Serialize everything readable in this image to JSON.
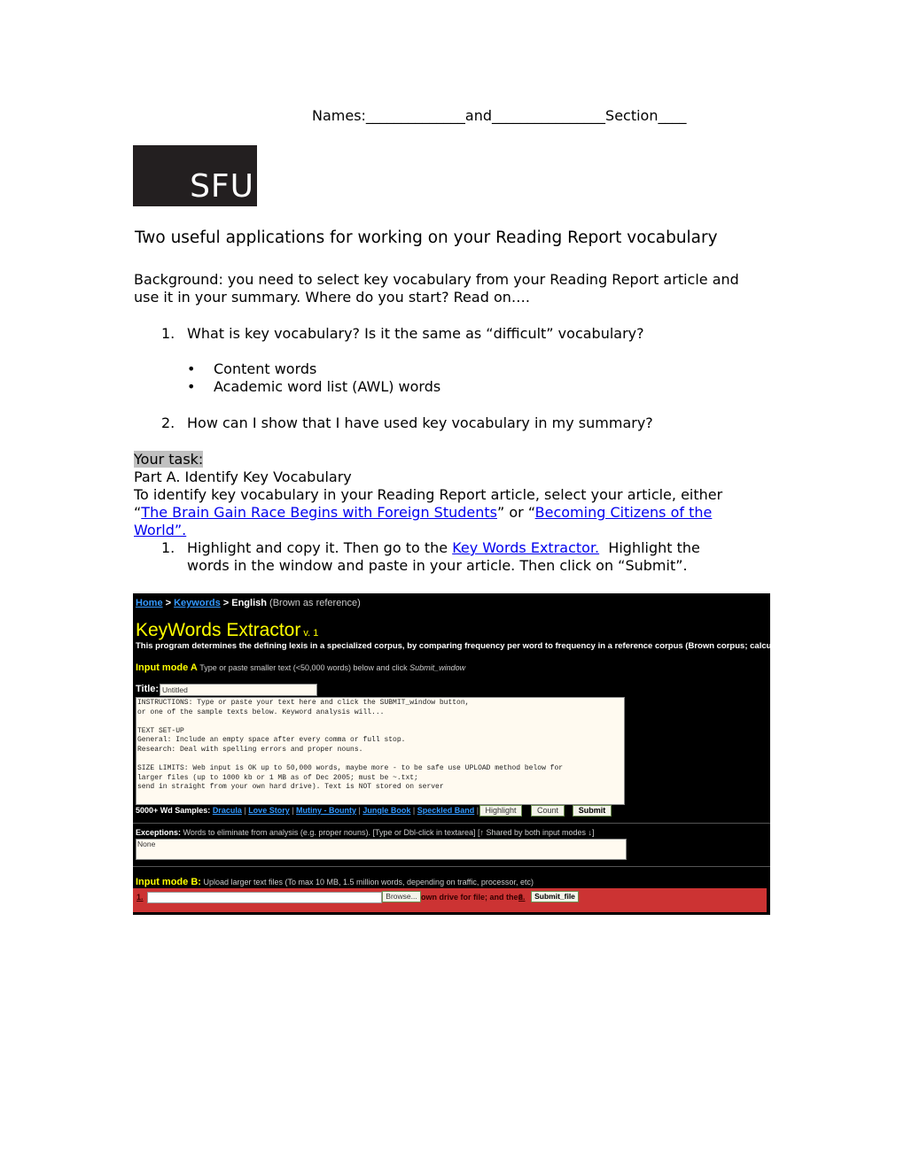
{
  "header": {
    "names_line": "Names:______________and________________Section____"
  },
  "logo": {
    "text": "SFU"
  },
  "heading": "Two useful applications for working on your Reading Report vocabulary",
  "background": {
    "line1": "Background: you need to select key vocabulary from your Reading Report article and",
    "line2": "use it in your summary.  Where do you start? Read on…."
  },
  "questions": [
    {
      "number": "1.",
      "text": "What is key vocabulary? Is it the same as “difficult” vocabulary?"
    },
    {
      "number": "2.",
      "text": "How can I show that I have used key vocabulary in my summary?"
    }
  ],
  "bullets": [
    "Content words",
    "Academic word list (AWL) words"
  ],
  "task": {
    "label": "Your task:",
    "part_a": "Part A. Identify Key Vocabulary",
    "intro": "To identify key vocabulary in your Reading Report article, select your article, either",
    "open_quote1": "“",
    "link1": "The Brain Gain Race Begins with Foreign Students",
    "mid": "” or “",
    "link2a": "Becoming Citizens of the ",
    "link2b": "World”. ",
    "step_number": "1.",
    "step_pre": "Highlight and copy it. Then go to the ",
    "step_link": "Key Words Extractor.",
    "step_post1": "  Highlight the",
    "step_post2": "words in the window and paste in your article. Then click on “Submit”."
  },
  "screenshot": {
    "breadcrumb": {
      "home": "Home",
      "sep1": " > ",
      "keywords": "Keywords",
      "sep2": " > ",
      "english": "English",
      "ref": " (Brown as reference)"
    },
    "app_title": "KeyWords Extractor",
    "version": " v. 1",
    "description": "This program determines the defining lexis in a specialized corpus, by comparing frequency per word to frequency in a reference corpus (Brown corpus; calculated on a",
    "mode_a_label": "Input mode A",
    "mode_a_text": " Type or paste smaller text (<50,000 words) below and click ",
    "mode_a_em": "Submit_window",
    "title_label": "Title:",
    "title_value": "Untitled",
    "textarea": "INSTRUCTIONS: Type or paste your text here and click the SUBMIT_window button,\nor one of the sample texts below. Keyword analysis will...\n\nTEXT SET-UP\nGeneral: Include an empty space after every comma or full stop.\nResearch: Deal with spelling errors and proper nouns.\n\nSIZE LIMITS: Web input is OK up to 50,000 words, maybe more - to be safe use UPLOAD method below for\nlarger files (up to 1000 kb or 1 MB as of Dec 2005; must be ~.txt;\nsend in straight from your own hard drive). Text is NOT stored on server",
    "samples_label": "5000+ Wd Samples:",
    "samples": [
      "Dracula",
      "Love Story",
      "Mutiny - Bounty",
      "Jungle Book",
      "Speckled Band"
    ],
    "separator": " | ",
    "buttons": {
      "highlight": "Highlight",
      "count": "Count",
      "submit": "Submit"
    },
    "exceptions_label": "Exceptions:",
    "exceptions_text": " Words to eliminate from analysis (e.g. proper nouns). [Type or Dbl-click in textarea] [↑ Shared by both input modes ↓]",
    "exceptions_value": "None",
    "mode_b_label": "Input mode B:",
    "mode_b_text": " Upload larger text files (To max 10 MB, 1.5 million words, depending on traffic, processor, etc)",
    "step1": "1.",
    "browse": "Browse...",
    "own_drive": "own drive for file; and then",
    "step2": "2.",
    "submit_file": "Submit_file"
  }
}
